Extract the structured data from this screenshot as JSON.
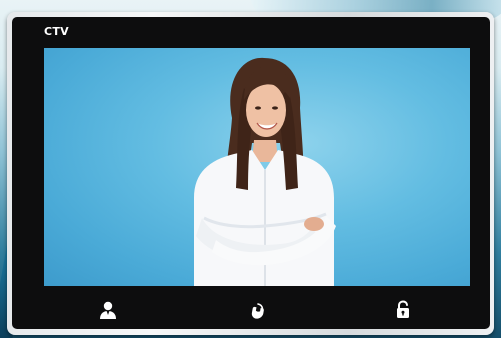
{
  "device": {
    "brand_logo": "CTV"
  },
  "controls": {
    "buttons": [
      {
        "icon": "user-icon"
      },
      {
        "icon": "handset-icon"
      },
      {
        "icon": "unlock-icon"
      }
    ]
  },
  "colors": {
    "panel": "#0d0d0e",
    "screen_background": "#5bb7df",
    "icon": "#ffffff"
  }
}
